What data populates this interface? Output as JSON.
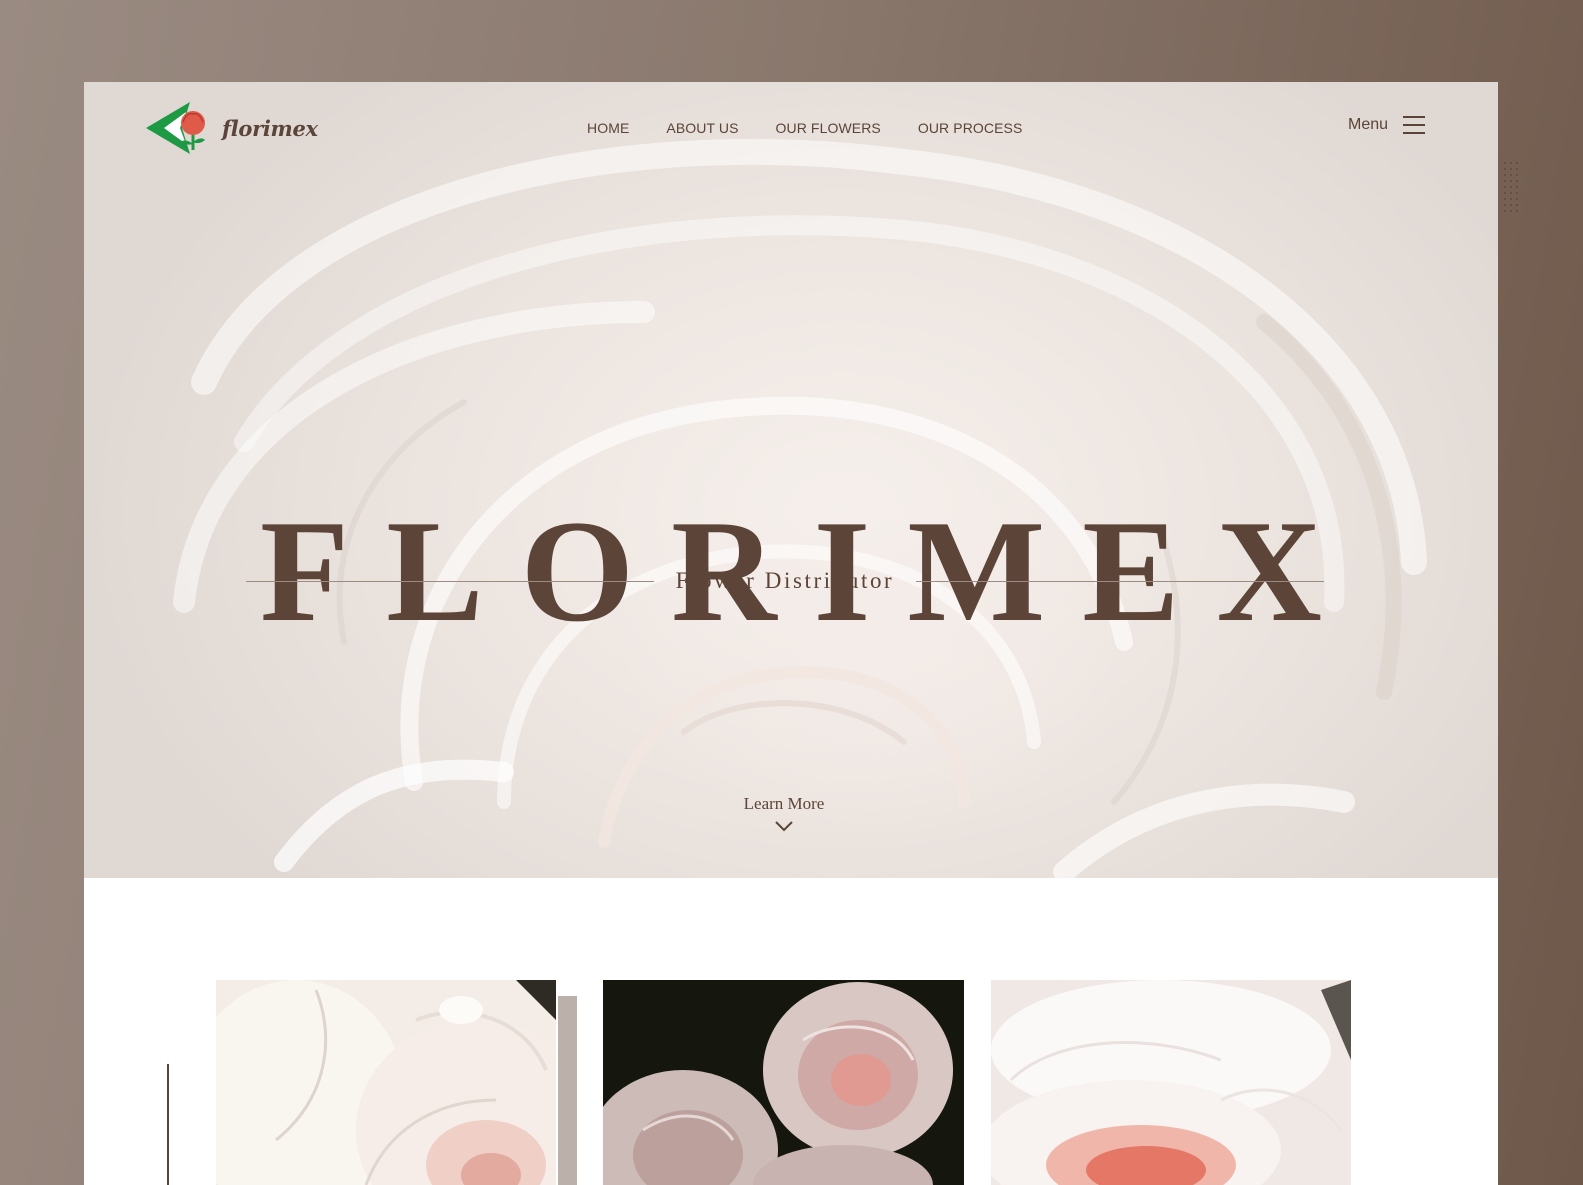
{
  "brand": {
    "logo_text": "florimex",
    "logo_icon": "tulip-arrow-logo-icon",
    "colors": {
      "logo_green": "#1e9a45",
      "logo_red": "#e05a4a",
      "text_brown": "#5c4438"
    }
  },
  "nav": {
    "items": [
      {
        "label": "HOME"
      },
      {
        "label": "ABOUT US"
      },
      {
        "label": "OUR FLOWERS"
      },
      {
        "label": "OUR PROCESS"
      }
    ],
    "menu_label": "Menu",
    "menu_icon": "hamburger-icon"
  },
  "hero": {
    "title": "FLORIMEX",
    "subtitle": "Flower Distributor",
    "cta_label": "Learn More",
    "cta_icon": "chevron-down-icon"
  },
  "gallery": {
    "tiles": [
      {
        "name": "white-roses-image"
      },
      {
        "name": "pink-roses-dark-image"
      },
      {
        "name": "peony-image"
      }
    ]
  }
}
